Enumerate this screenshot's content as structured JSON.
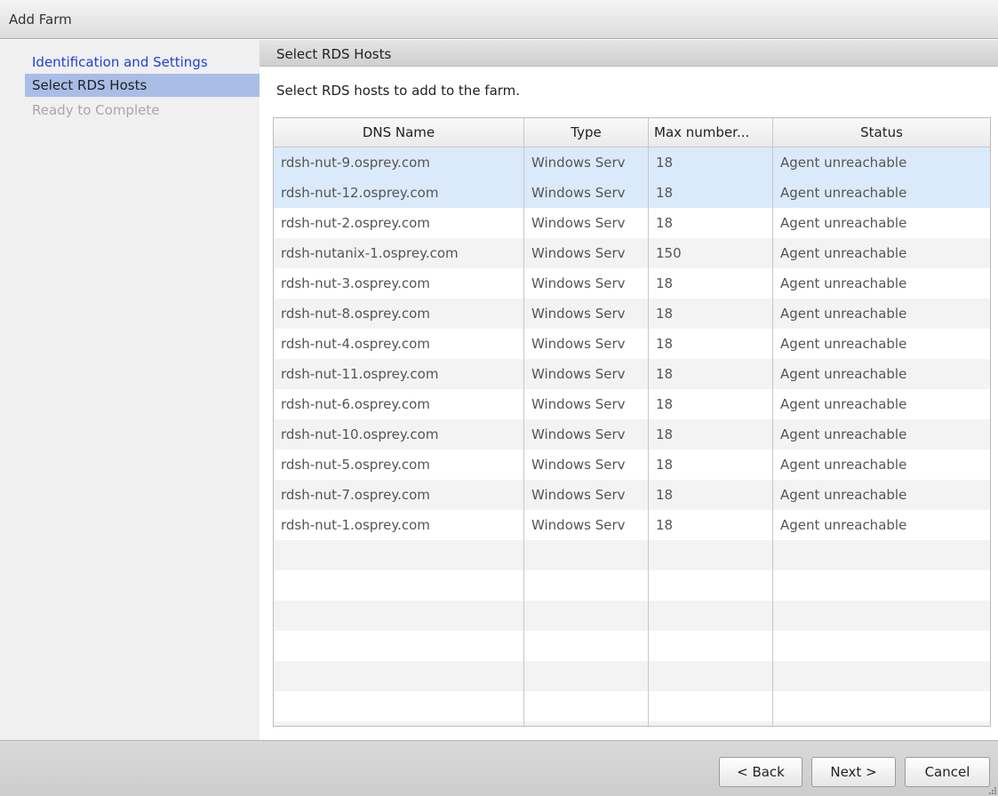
{
  "window": {
    "title": "Add Farm"
  },
  "sidebar": {
    "items": [
      {
        "label": "Identification and Settings",
        "state": "done"
      },
      {
        "label": "Select RDS Hosts",
        "state": "current"
      },
      {
        "label": "Ready to Complete",
        "state": "disabled"
      }
    ]
  },
  "main": {
    "section_title": "Select RDS Hosts",
    "instruction": "Select RDS hosts to add to the farm.",
    "table": {
      "columns": [
        "DNS Name",
        "Type",
        "Max number...",
        "Status"
      ],
      "rows": [
        {
          "dns": "rdsh-nut-9.osprey.com",
          "type": "Windows Serv",
          "max": "18",
          "status": "Agent unreachable",
          "selected": true
        },
        {
          "dns": "rdsh-nut-12.osprey.com",
          "type": "Windows Serv",
          "max": "18",
          "status": "Agent unreachable",
          "selected": true
        },
        {
          "dns": "rdsh-nut-2.osprey.com",
          "type": "Windows Serv",
          "max": "18",
          "status": "Agent unreachable",
          "selected": false
        },
        {
          "dns": "rdsh-nutanix-1.osprey.com",
          "type": "Windows Serv",
          "max": "150",
          "status": "Agent unreachable",
          "selected": false
        },
        {
          "dns": "rdsh-nut-3.osprey.com",
          "type": "Windows Serv",
          "max": "18",
          "status": "Agent unreachable",
          "selected": false
        },
        {
          "dns": "rdsh-nut-8.osprey.com",
          "type": "Windows Serv",
          "max": "18",
          "status": "Agent unreachable",
          "selected": false
        },
        {
          "dns": "rdsh-nut-4.osprey.com",
          "type": "Windows Serv",
          "max": "18",
          "status": "Agent unreachable",
          "selected": false
        },
        {
          "dns": "rdsh-nut-11.osprey.com",
          "type": "Windows Serv",
          "max": "18",
          "status": "Agent unreachable",
          "selected": false
        },
        {
          "dns": "rdsh-nut-6.osprey.com",
          "type": "Windows Serv",
          "max": "18",
          "status": "Agent unreachable",
          "selected": false
        },
        {
          "dns": "rdsh-nut-10.osprey.com",
          "type": "Windows Serv",
          "max": "18",
          "status": "Agent unreachable",
          "selected": false
        },
        {
          "dns": "rdsh-nut-5.osprey.com",
          "type": "Windows Serv",
          "max": "18",
          "status": "Agent unreachable",
          "selected": false
        },
        {
          "dns": "rdsh-nut-7.osprey.com",
          "type": "Windows Serv",
          "max": "18",
          "status": "Agent unreachable",
          "selected": false
        },
        {
          "dns": "rdsh-nut-1.osprey.com",
          "type": "Windows Serv",
          "max": "18",
          "status": "Agent unreachable",
          "selected": false
        }
      ]
    }
  },
  "footer": {
    "back_label": "< Back",
    "next_label": "Next >",
    "cancel_label": "Cancel"
  },
  "colors": {
    "nav_done": "#1f3ee0",
    "nav_current_bg": "#a9bde6",
    "nav_disabled": "#a8a8a8",
    "row_selected_bg": "#dbeafa"
  }
}
